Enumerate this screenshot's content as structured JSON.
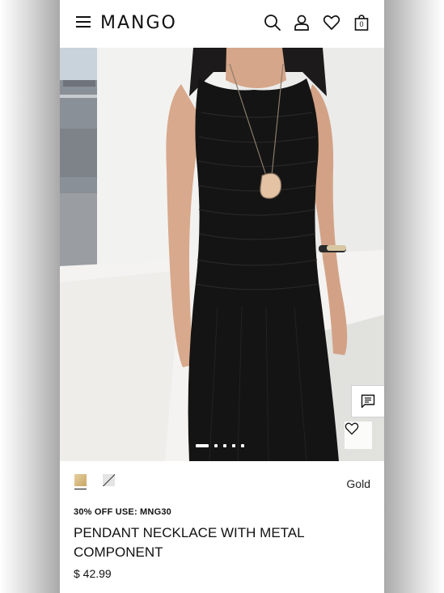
{
  "header": {
    "brand": "MANGO",
    "bag_count": "0"
  },
  "icons": {
    "menu": "hamburger-menu-icon",
    "search": "search-icon",
    "account": "user-icon",
    "wishlist": "heart-icon",
    "bag": "shopping-bag-icon",
    "chat": "chat-icon"
  },
  "gallery": {
    "slide_count": 5,
    "active_slide": 1
  },
  "product": {
    "selected_color": "Gold",
    "swatches": [
      "Gold",
      "Silver"
    ],
    "promo": "30% OFF USE: MNG30",
    "title": "PENDANT NECKLACE WITH METAL COMPONENT",
    "price": "$ 42.99"
  },
  "colors": {
    "accent": "#111111",
    "swatch_gold": "#d4b67c",
    "background": "#ffffff"
  }
}
